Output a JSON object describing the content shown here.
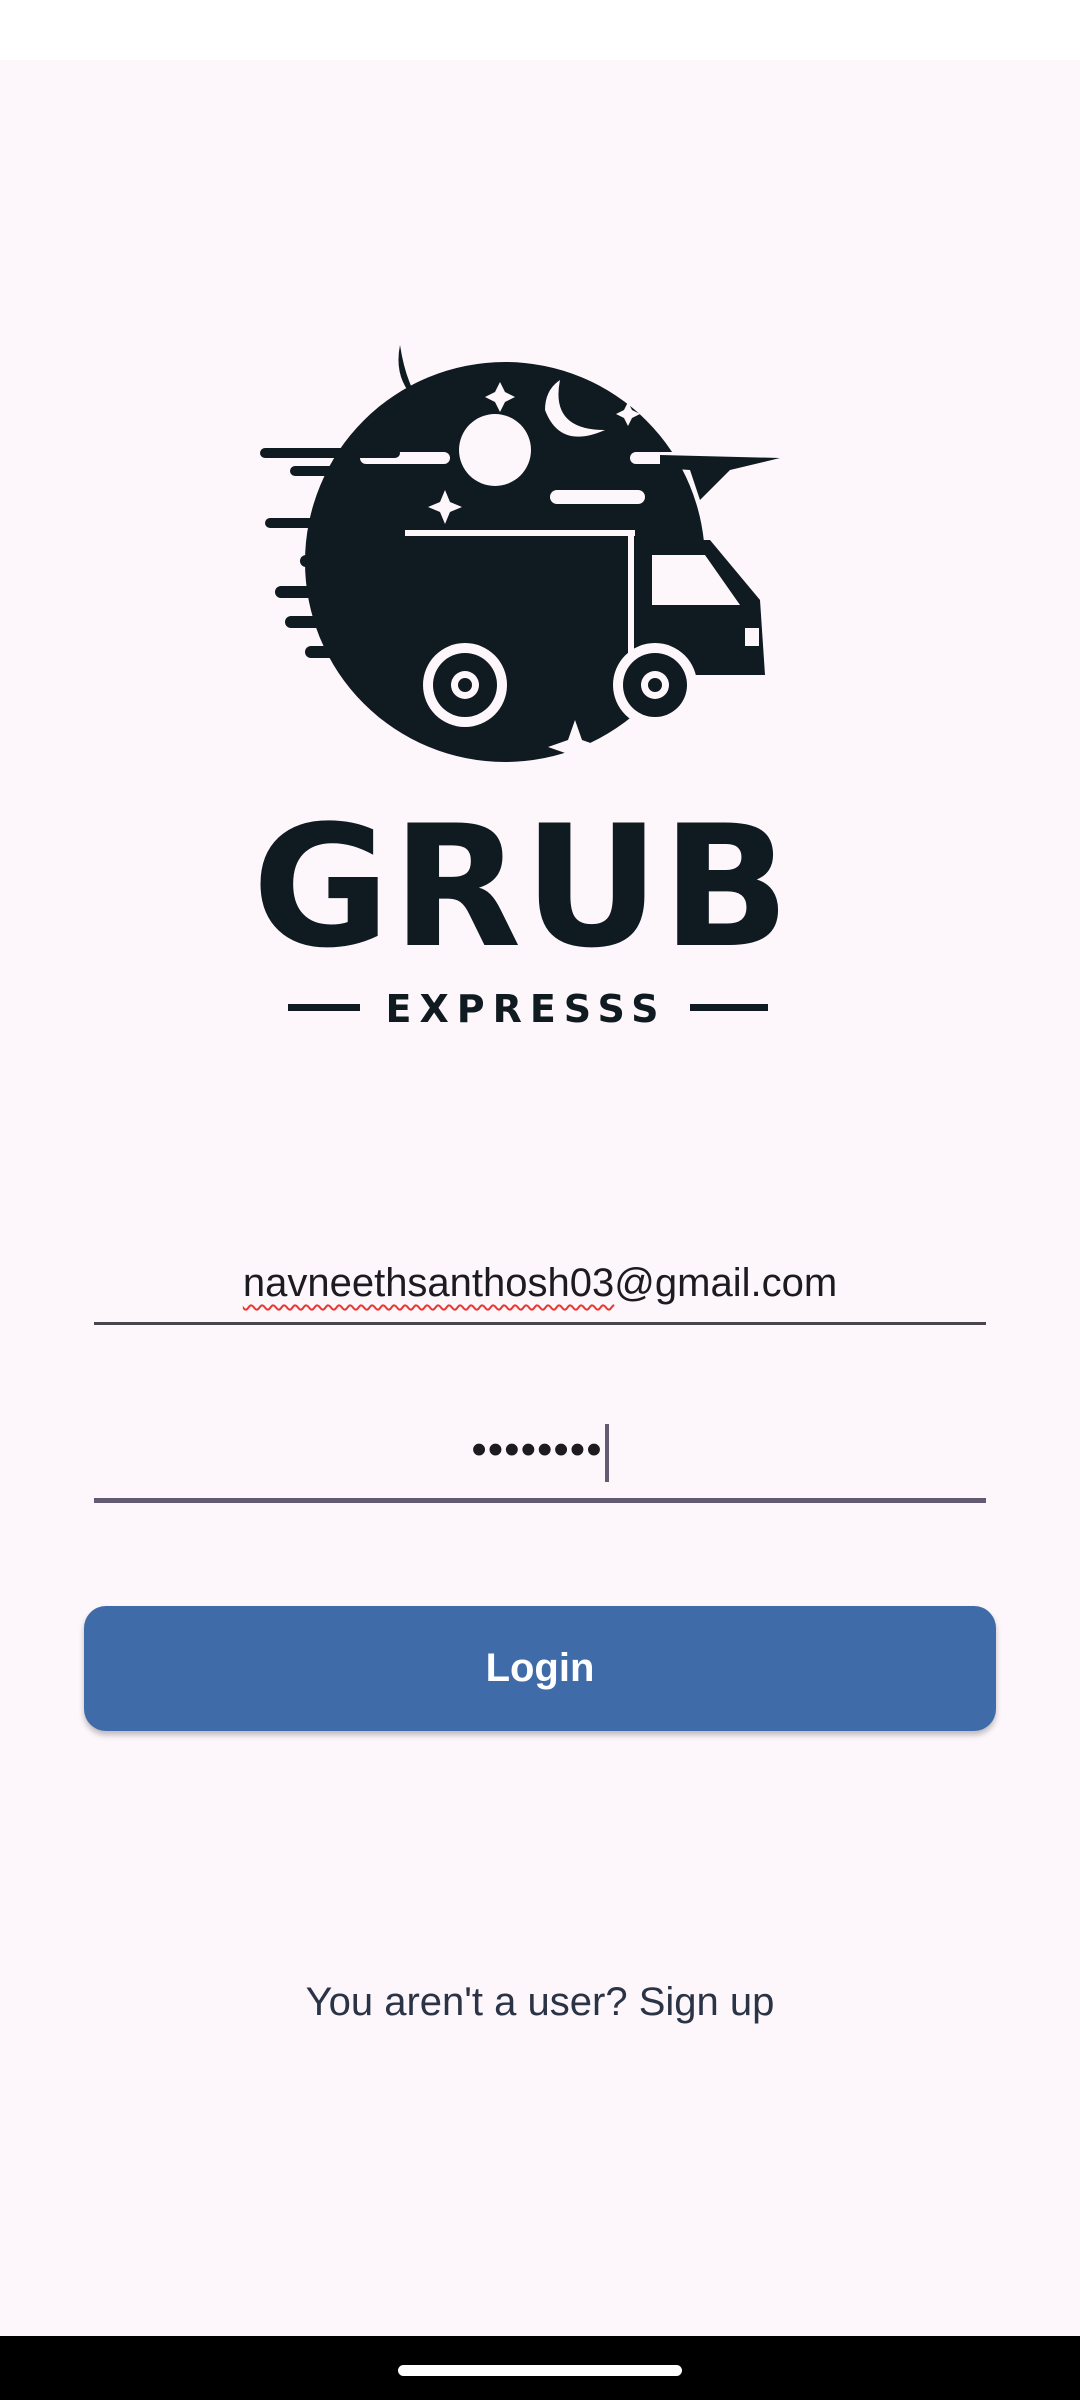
{
  "app": {
    "logo": {
      "title": "GRUB",
      "subtitle": "EXPRESSS",
      "icon": "delivery-van-icon"
    }
  },
  "login_form": {
    "email": {
      "value_misspelled_part": "navneethsanthosh03",
      "value_rest": "@gmail.com"
    },
    "password": {
      "masked_value": "••••••••"
    },
    "login_button": {
      "label": "Login"
    },
    "signup_prompt": "You aren't a user? Sign up"
  },
  "colors": {
    "primary": "#3f6ca8",
    "background": "#fdf7fb",
    "logo": "#0f1a21"
  }
}
